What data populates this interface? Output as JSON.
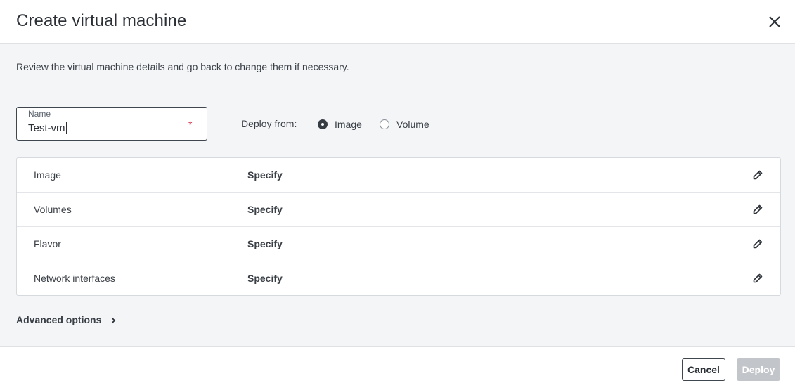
{
  "dialog": {
    "title": "Create virtual machine",
    "subtitle": "Review the virtual machine details and go back to change them if necessary."
  },
  "name_field": {
    "label": "Name",
    "value": "Test-vm",
    "required_marker": "*"
  },
  "deploy_from": {
    "label": "Deploy from:",
    "options": [
      {
        "label": "Image",
        "selected": true
      },
      {
        "label": "Volume",
        "selected": false
      }
    ]
  },
  "summary_rows": [
    {
      "label": "Image",
      "value": "Specify",
      "icon": "pencil-icon"
    },
    {
      "label": "Volumes",
      "value": "Specify",
      "icon": "pencil-icon"
    },
    {
      "label": "Flavor",
      "value": "Specify",
      "icon": "pencil-icon"
    },
    {
      "label": "Network interfaces",
      "value": "Specify",
      "icon": "pencil-icon"
    }
  ],
  "advanced_options": {
    "label": "Advanced options",
    "icon": "chevron-right-icon"
  },
  "footer": {
    "cancel_label": "Cancel",
    "deploy_label": "Deploy",
    "deploy_enabled": false
  },
  "colors": {
    "body_background": "#f4f5f7",
    "required": "#d6334b",
    "disabled_button": "#c2c5ca"
  }
}
